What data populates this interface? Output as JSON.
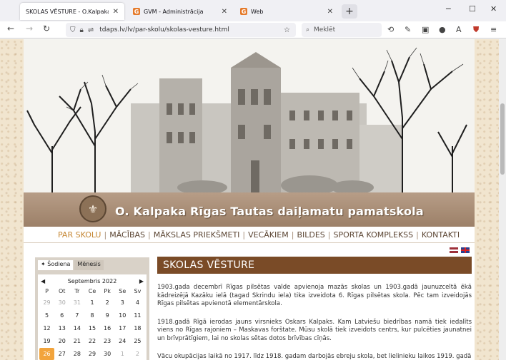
{
  "browser": {
    "tabs": [
      {
        "label": "SKOLAS VĒSTURE - O.Kalpaka Rīgas",
        "active": true,
        "favicon": ""
      },
      {
        "label": "GVM - Administrācija",
        "active": false,
        "favicon": "G"
      },
      {
        "label": "Web",
        "active": false,
        "favicon": "G"
      }
    ],
    "new_tab": "+",
    "url": "tdaps.lv/lv/par-skolu/skolas-vesture.html",
    "search_placeholder": "Meklēt"
  },
  "site": {
    "school_name": "O. Kalpaka Rīgas Tautas daiļamatu pamatskola",
    "menu": [
      "PAR SKOLU",
      "MĀCĪBAS",
      "MĀKSLAS PRIEKŠMETI",
      "VECĀKIEM",
      "BILDES",
      "SPORTA KOMPLEKSS",
      "KONTAKTI"
    ],
    "menu_active": "PAR SKOLU"
  },
  "calendar": {
    "tabs": [
      "Šodiena",
      "Mēnesis"
    ],
    "tab_icon": "✦",
    "month": "Septembris 2022",
    "day_names": [
      "P",
      "Ot",
      "Tr",
      "Ce",
      "Pk",
      "Se",
      "Sv"
    ],
    "weeks": [
      [
        "29",
        "30",
        "31",
        "1",
        "2",
        "3",
        "4"
      ],
      [
        "5",
        "6",
        "7",
        "8",
        "9",
        "10",
        "11"
      ],
      [
        "12",
        "13",
        "14",
        "15",
        "16",
        "17",
        "18"
      ],
      [
        "19",
        "20",
        "21",
        "22",
        "23",
        "24",
        "25"
      ],
      [
        "26",
        "27",
        "28",
        "29",
        "30",
        "1",
        "2"
      ]
    ],
    "muted": [
      [
        0,
        0
      ],
      [
        0,
        1
      ],
      [
        0,
        2
      ],
      [
        4,
        5
      ],
      [
        4,
        6
      ]
    ],
    "today": [
      4,
      0
    ]
  },
  "article": {
    "title": "SKOLAS VĒSTURE",
    "paragraphs": [
      "1903.gada decembrī Rīgas pilsētas valde apvienoja mazās skolas un 1903.gadā jaunuzceltā ēkā kādreizējā Kazāku ielā (tagad Skrindu iela) tika izveidota 6. Rīgas pilsētas skola. Pēc tam izveidojās Rīgas pilsētas apvienotā elementārskola.",
      "1918.gadā Rīgā ierodas jauns virsnieks Oskars Kalpaks. Kam Latviešu biedrības namā tiek iedalīts viens no Rīgas rajoniem – Maskavas forštate. Mūsu skolā tiek izveidots centrs, kur pulcēties jaunatnei un brīvprātīgiem, lai no skolas sētas dotos brīvības cīņās.",
      "Vācu okupācijas laikā no 1917. līdz 1918. gadam darbojās ebreju skola, bet lielinieku laikos 1919. gadā"
    ]
  },
  "colors": {
    "accent_menu": "#c58734",
    "title_bar": "#7a4b27",
    "today": "#f2a43c"
  }
}
